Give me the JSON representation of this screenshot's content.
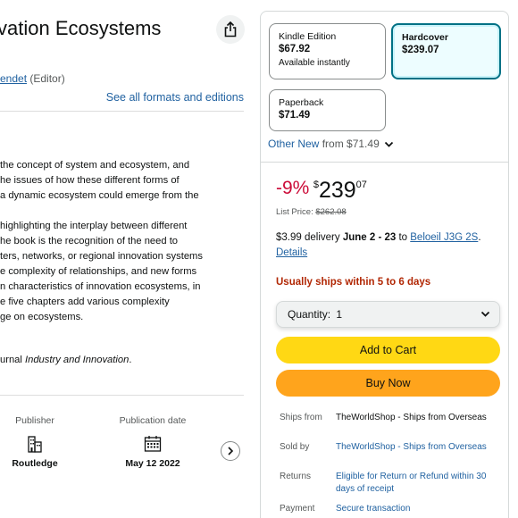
{
  "product": {
    "title": "vation Ecosystems",
    "author_name": "endet",
    "author_role": "(Editor)",
    "formats_link": "See all formats and editions"
  },
  "description": {
    "lines_a": [
      "the concept of system and ecosystem, and",
      "he issues of how these different forms of",
      "a dynamic ecosystem could emerge from the"
    ],
    "lines_b": [
      "highlighting the interplay between different",
      "he book is the recognition of the need to",
      "ters, networks, or regional innovation systems",
      "e complexity of relationships, and new forms",
      "n characteristics of innovation ecosystems, in",
      "e five chapters add various complexity",
      "ge on ecosystems."
    ],
    "journal_prefix": "urnal ",
    "journal_name": "Industry and Innovation",
    "journal_suffix": "."
  },
  "details": {
    "publisher_label": "Publisher",
    "publisher_value": "Routledge",
    "publisher_icon": "building-icon",
    "date_label": "Publication date",
    "date_value": "May 12 2022",
    "date_icon": "calendar-icon"
  },
  "formats": [
    {
      "name": "Kindle Edition",
      "price": "$67.92",
      "sub": "Available instantly",
      "selected": false
    },
    {
      "name": "Hardcover",
      "price": "$239.07",
      "sub": "",
      "selected": true
    },
    {
      "name": "Paperback",
      "price": "$71.49",
      "sub": "",
      "selected": false
    }
  ],
  "other_new": {
    "label": "Other New",
    "from": "from $71.49"
  },
  "buybox": {
    "discount": "-9%",
    "currency": "$",
    "price_whole": "239",
    "price_fraction": "07",
    "list_price_label": "List Price:",
    "list_price": "$262.08",
    "delivery_prefix": "$3.99 delivery",
    "delivery_dates": "June 2 - 23",
    "delivery_to": "to",
    "delivery_location": "Beloeil J3G 2S",
    "details_link": "Details",
    "stock": "Usually ships within 5 to 6 days",
    "quantity_label": "Quantity:",
    "quantity_value": "1",
    "add_to_cart": "Add to Cart",
    "buy_now": "Buy Now"
  },
  "seller_info": [
    {
      "key": "Ships from",
      "value": "TheWorldShop - Ships from Overseas",
      "link": false
    },
    {
      "key": "Sold by",
      "value": "TheWorldShop - Ships from Overseas",
      "link": true
    },
    {
      "key": "Returns",
      "value": "Eligible for Return or Refund within 30 days of receipt",
      "link": true
    },
    {
      "key": "Payment",
      "value": "Secure transaction",
      "link": true
    }
  ],
  "colors": {
    "link": "#2162a1",
    "discount": "#cc0c39",
    "stock": "#b12704",
    "cart_button": "#ffd814",
    "buy_button": "#ffa41c",
    "selected_border": "#007185"
  }
}
